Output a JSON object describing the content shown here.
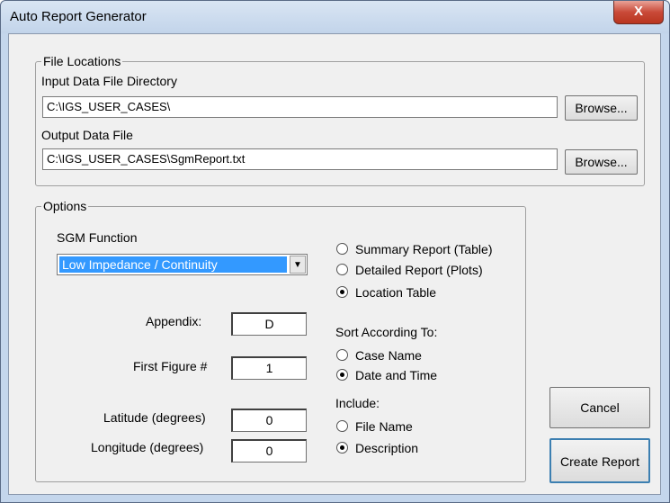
{
  "window": {
    "title": "Auto Report Generator",
    "close_glyph": "X"
  },
  "file_locations": {
    "legend": "File Locations",
    "input_label": "Input Data File Directory",
    "input_value": "C:\\IGS_USER_CASES\\",
    "output_label": "Output Data File",
    "output_value": "C:\\IGS_USER_CASES\\SgmReport.txt",
    "browse_label": "Browse..."
  },
  "options": {
    "legend": "Options",
    "sgm_label": "SGM Function",
    "sgm_selected": "Low Impedance / Continuity",
    "appendix_label": "Appendix:",
    "appendix_value": "D",
    "first_figure_label": "First Figure #",
    "first_figure_value": "1",
    "latitude_label": "Latitude (degrees)",
    "latitude_value": "0",
    "longitude_label": "Longitude (degrees)",
    "longitude_value": "0",
    "report_types": [
      {
        "label": "Summary Report (Table)",
        "selected": false
      },
      {
        "label": "Detailed Report (Plots)",
        "selected": false
      },
      {
        "label": "Location Table",
        "selected": true
      }
    ],
    "sort_label": "Sort According To:",
    "sort_options": [
      {
        "label": "Case Name",
        "selected": false
      },
      {
        "label": "Date and Time",
        "selected": true
      }
    ],
    "include_label": "Include:",
    "include_options": [
      {
        "label": "File Name",
        "selected": false
      },
      {
        "label": "Description",
        "selected": true
      }
    ]
  },
  "buttons": {
    "cancel": "Cancel",
    "create_report": "Create Report"
  }
}
